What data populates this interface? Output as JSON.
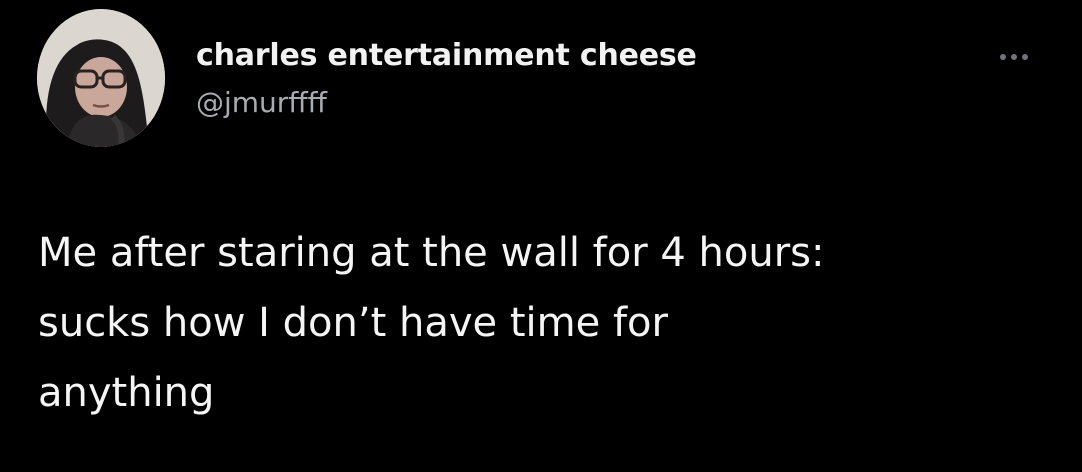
{
  "tweet": {
    "author": {
      "display_name": "charles entertainment cheese",
      "handle": "@jmurffff",
      "avatar_icon": "user-avatar-photo"
    },
    "more_icon": "more-options-icon",
    "text_lines": [
      "Me after staring at the wall for 4 hours:",
      "sucks how I don’t have time for",
      "anything"
    ]
  },
  "colors": {
    "background": "#000000",
    "name": "#f2f2f2",
    "handle": "#a8acb0",
    "text": "#f5f5f5"
  }
}
